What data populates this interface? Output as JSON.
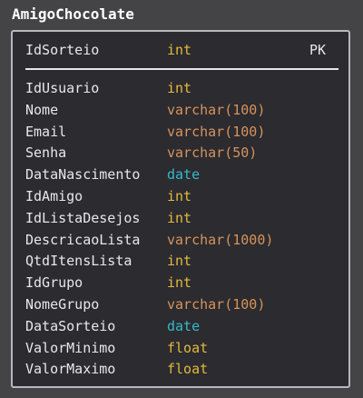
{
  "table": {
    "name": "AmigoChocolate",
    "primary_key": {
      "name": "IdSorteio",
      "type": "int",
      "key": "PK",
      "color": "#e2b93b"
    },
    "columns": [
      {
        "name": "IdUsuario",
        "type": "int",
        "color": "#e2b93b"
      },
      {
        "name": "Nome",
        "type": "varchar(100)",
        "color": "#d7935a"
      },
      {
        "name": "Email",
        "type": "varchar(100)",
        "color": "#d7935a"
      },
      {
        "name": "Senha",
        "type": "varchar(50)",
        "color": "#d7935a"
      },
      {
        "name": "DataNascimento",
        "type": "date",
        "color": "#35b9c9"
      },
      {
        "name": "IdAmigo",
        "type": "int",
        "color": "#e2b93b"
      },
      {
        "name": "IdListaDesejos",
        "type": "int",
        "color": "#e2b93b"
      },
      {
        "name": "DescricaoLista",
        "type": "varchar(1000)",
        "color": "#d7935a"
      },
      {
        "name": "QtdItensLista",
        "type": "int",
        "color": "#e2b93b"
      },
      {
        "name": "IdGrupo",
        "type": "int",
        "color": "#e2b93b"
      },
      {
        "name": "NomeGrupo",
        "type": "varchar(100)",
        "color": "#d7935a"
      },
      {
        "name": "DataSorteio",
        "type": "date",
        "color": "#35b9c9"
      },
      {
        "name": "ValorMinimo",
        "type": "float",
        "color": "#e2b93b"
      },
      {
        "name": "ValorMaximo",
        "type": "float",
        "color": "#e2b93b"
      }
    ]
  }
}
